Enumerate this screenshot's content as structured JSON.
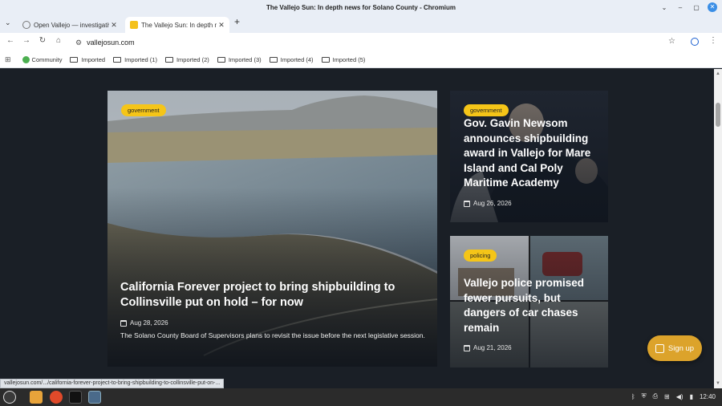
{
  "window": {
    "title": "The Vallejo Sun: In depth news for Solano County - Chromium",
    "controls": [
      "⌄",
      "–",
      "▢",
      "✕"
    ]
  },
  "tabs": [
    {
      "label": "Open Vallejo — investigative",
      "active": false
    },
    {
      "label": "The Vallejo Sun: In depth news",
      "active": true
    }
  ],
  "toolbar": {
    "url": "vallejosun.com",
    "back_icon": "back-arrow-icon",
    "forward_icon": "forward-arrow-icon",
    "reload_icon": "reload-icon",
    "home_icon": "home-icon"
  },
  "bookmarks": [
    {
      "label": "Community",
      "icon": "community-icon"
    },
    {
      "label": "Imported",
      "icon": "folder-icon"
    },
    {
      "label": "Imported (1)",
      "icon": "folder-icon"
    },
    {
      "label": "Imported (2)",
      "icon": "folder-icon"
    },
    {
      "label": "Imported (3)",
      "icon": "folder-icon"
    },
    {
      "label": "Imported (4)",
      "icon": "folder-icon"
    },
    {
      "label": "Imported (5)",
      "icon": "folder-icon"
    }
  ],
  "articles": {
    "main": {
      "tag": "government",
      "headline": "California Forever project to bring shipbuilding to Collinsville put on hold – for now",
      "date": "Aug 28, 2026",
      "dek": "The Solano County Board of Supervisors plans to revisit the issue before the next legislative session."
    },
    "top": {
      "tag": "government",
      "headline": "Gov. Gavin Newsom announces shipbuilding award in Vallejo for Mare Island and Cal Poly Maritime Academy",
      "date": "Aug 26, 2026"
    },
    "bottom": {
      "tag": "policing",
      "headline": "Vallejo police promised fewer pursuits, but dangers of car chases remain",
      "date": "Aug 21, 2026"
    }
  },
  "signup": {
    "label": "Sign up"
  },
  "status_url": "vallejosun.com/.../california-forever-project-to-bring-shipbuilding-to-collinsville-put-on-...",
  "taskbar": {
    "clock": "12:40"
  },
  "colors": {
    "page_bg": "#1a1f26",
    "badge": "#f5c518",
    "signup": "#dca32b"
  }
}
